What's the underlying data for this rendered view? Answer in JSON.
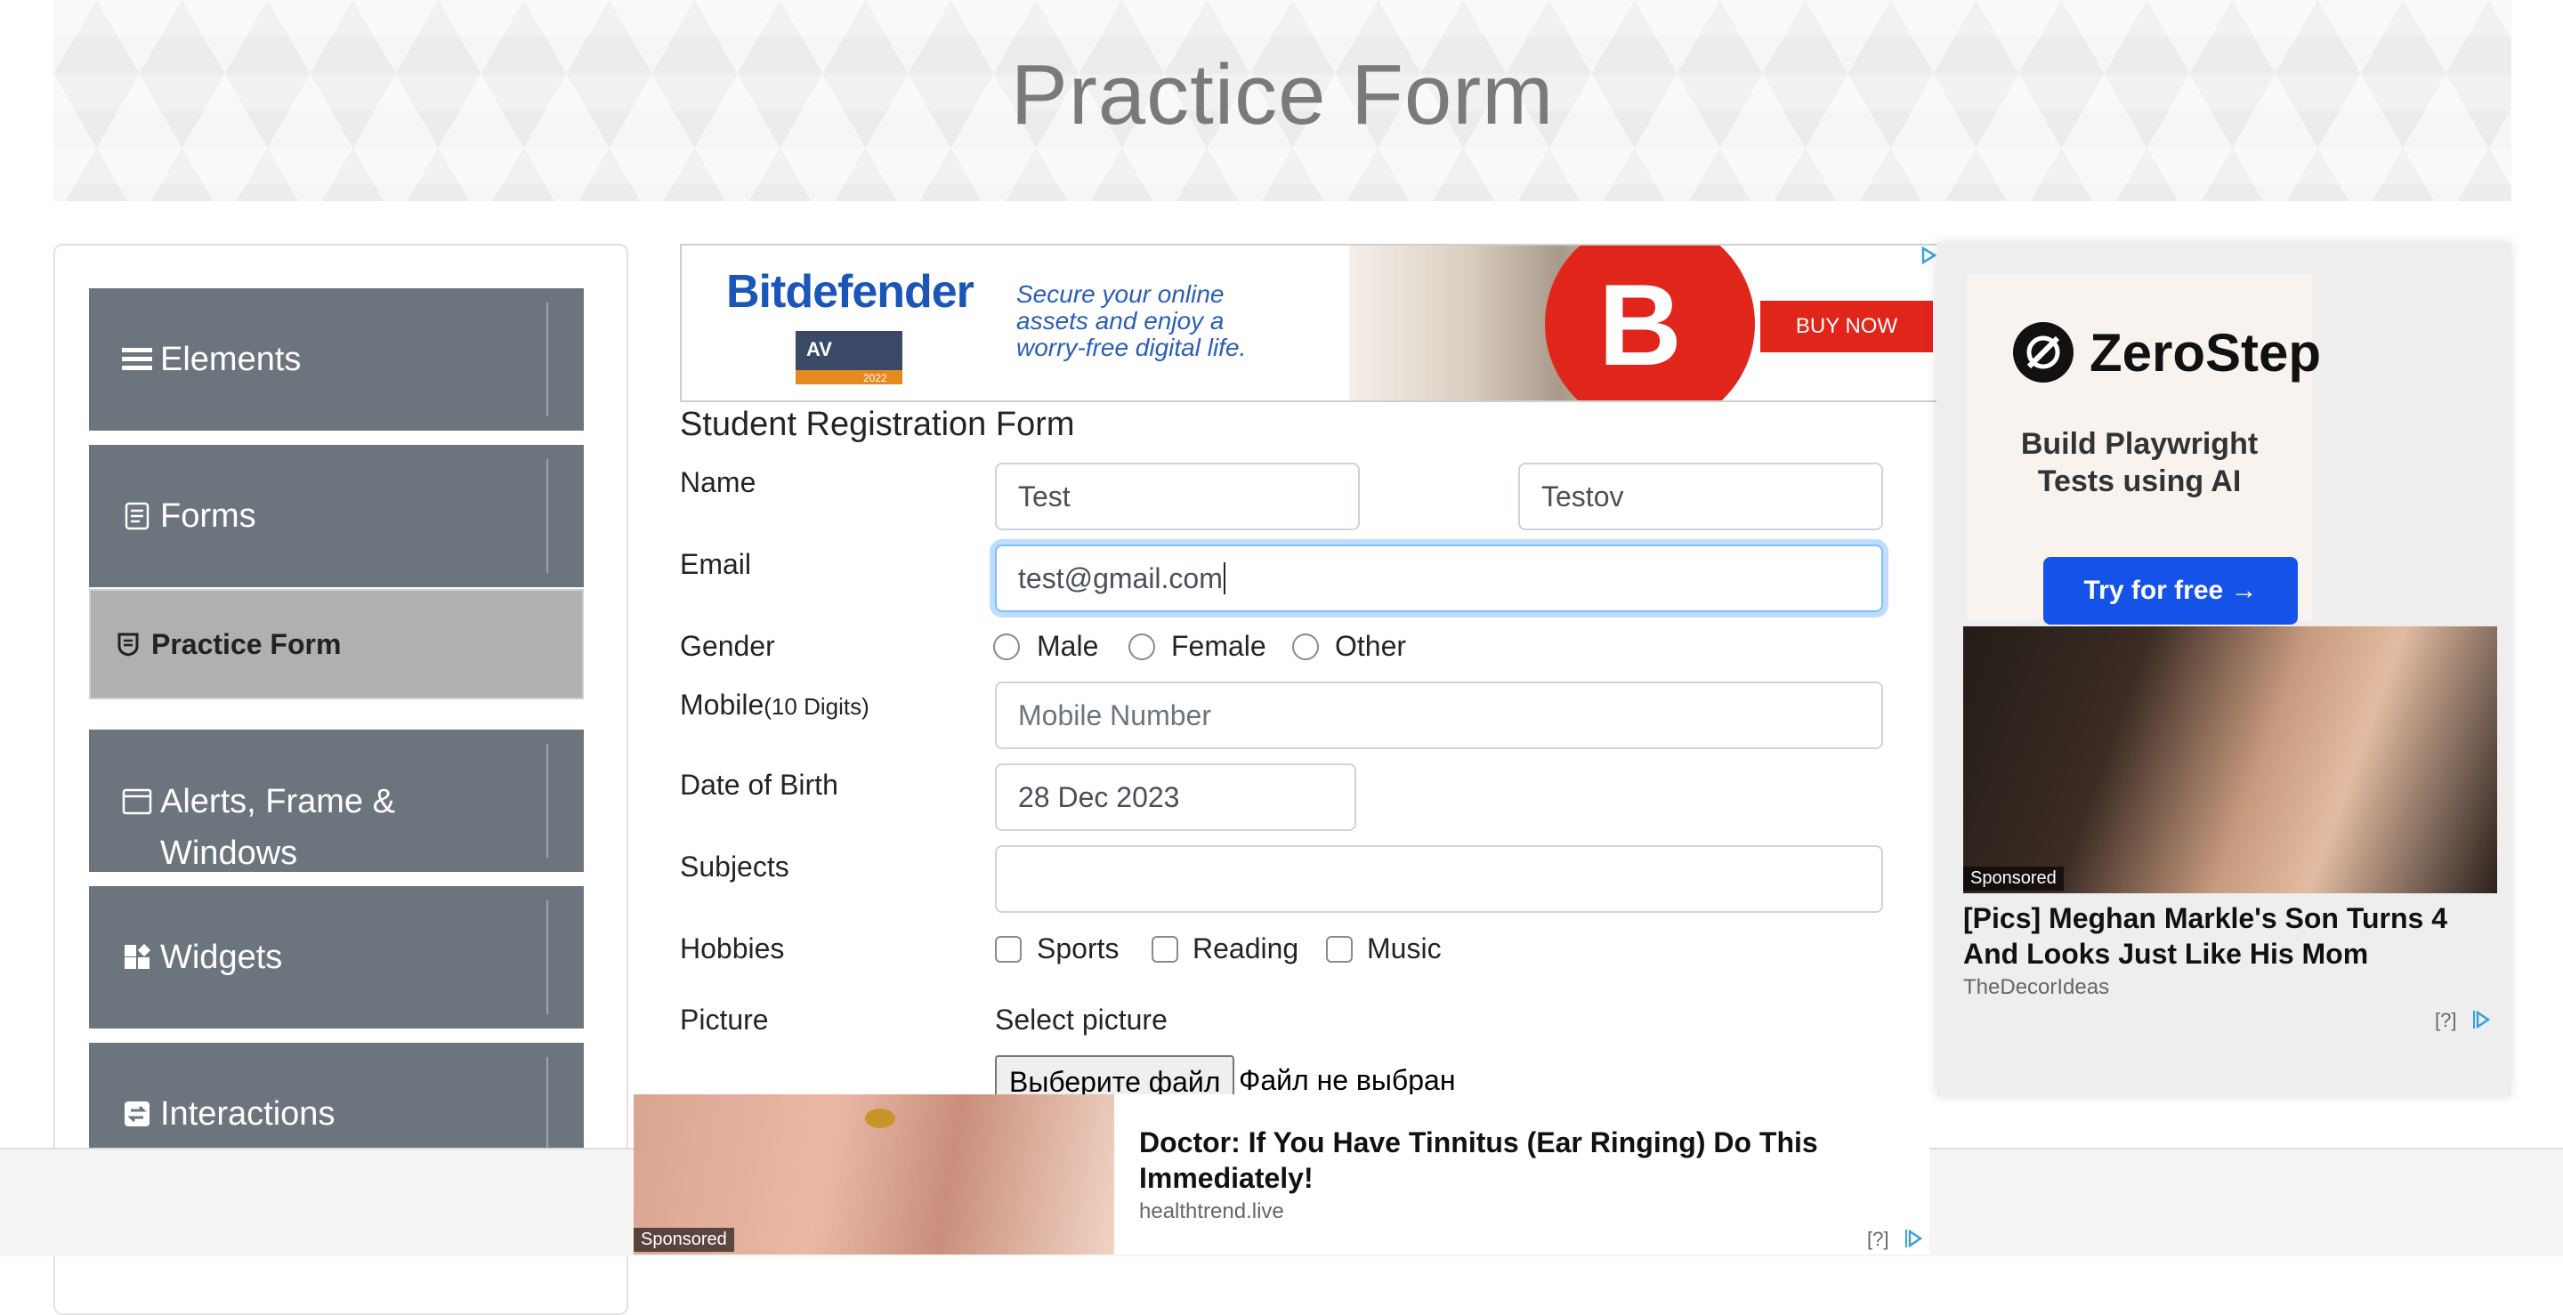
{
  "header": {
    "title": "Practice Form"
  },
  "sidebar": {
    "groups": [
      {
        "label": "Elements"
      },
      {
        "label": "Forms"
      },
      {
        "label": "Alerts, Frame &",
        "label2": "Windows"
      },
      {
        "label": "Widgets"
      },
      {
        "label": "Interactions"
      }
    ],
    "active_item": "Practice Form"
  },
  "top_ad": {
    "brand": "Bitdefender",
    "badge": "AV",
    "badge_year": "2022",
    "tagline": [
      "Secure your online",
      "assets and enjoy a",
      "worry-free digital life."
    ],
    "cta": "BUY NOW",
    "cta_color": "#e0251b"
  },
  "form": {
    "title": "Student Registration Form",
    "labels": {
      "name": "Name",
      "email": "Email",
      "gender": "Gender",
      "mobile": "Mobile",
      "mobile_hint": "(10 Digits)",
      "dob": "Date of Birth",
      "subjects": "Subjects",
      "hobbies": "Hobbies",
      "picture": "Picture"
    },
    "first_name": "Test",
    "last_name": "Testov",
    "email": "test@gmail.com",
    "gender_options": [
      "Male",
      "Female",
      "Other"
    ],
    "mobile_placeholder": "Mobile Number",
    "dob": "28 Dec 2023",
    "subjects": "",
    "hobby_options": [
      "Sports",
      "Reading",
      "Music"
    ],
    "picture_label": "Select picture",
    "file_button": "Выберите файл",
    "file_status": "Файл не выбран",
    "focus_color": "#80bdff"
  },
  "right_ad": {
    "brand": "ZeroStep",
    "tagline": [
      "Build Playwright",
      "Tests using AI"
    ],
    "cta": "Try for free →",
    "cta_color": "#1452e8",
    "sponsored": "Sponsored",
    "headline": [
      "[Pics] Meghan Markle's Son Turns 4",
      "And Looks Just Like His Mom"
    ],
    "source": "TheDecorIdeas",
    "info": "[?]"
  },
  "bottom_ad": {
    "sponsored": "Sponsored",
    "headline": [
      "Doctor: If You Have Tinnitus (Ear Ringing) Do This",
      "Immediately!"
    ],
    "source": "healthtrend.live",
    "info": "[?]"
  }
}
